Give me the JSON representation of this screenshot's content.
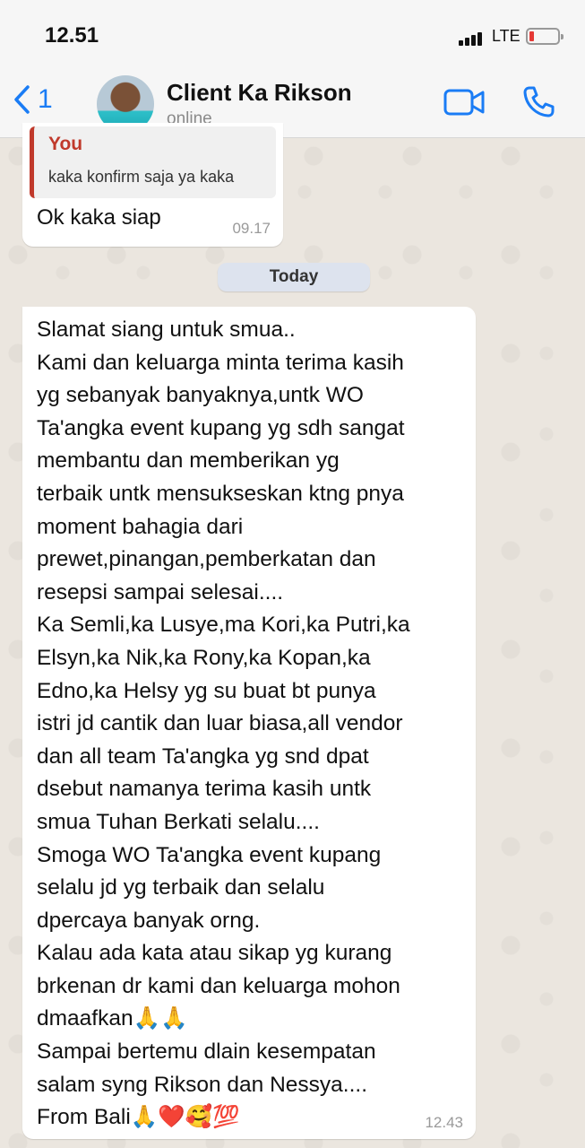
{
  "status_bar": {
    "time": "12.51",
    "network": "LTE",
    "battery_level": 0.1
  },
  "header": {
    "back_count": "1",
    "contact_name": "Client Ka Rikson",
    "contact_status": "online",
    "icons": [
      "chevron-left-icon",
      "video-icon",
      "phone-icon"
    ]
  },
  "messages": [
    {
      "quote_author": "You",
      "quote_text": "kaka konfirm saja ya kaka",
      "text": "Ok kaka siap",
      "time": "09.17"
    },
    {
      "lines": [
        "Slamat siang untuk smua..",
        "Kami dan keluarga minta terima kasih",
        "yg sebanyak banyaknya,untk WO",
        "Ta'angka event kupang yg sdh sangat",
        "membantu dan memberikan yg",
        "terbaik untk mensukseskan ktng pnya",
        "moment bahagia dari",
        "prewet,pinangan,pemberkatan dan",
        "resepsi sampai selesai....",
        "Ka Semli,ka Lusye,ma Kori,ka Putri,ka",
        "Elsyn,ka Nik,ka Rony,ka Kopan,ka",
        "Edno,ka Helsy yg su buat bt punya",
        "istri jd cantik dan luar biasa,all vendor",
        "dan all team Ta'angka yg snd dpat",
        "dsebut namanya terima kasih untk",
        "smua Tuhan Berkati selalu....",
        "Smoga WO Ta'angka event kupang",
        "selalu jd yg terbaik dan selalu",
        "dpercaya banyak orng.",
        "Kalau  ada kata atau sikap yg kurang",
        "brkenan dr kami dan keluarga mohon",
        "dmaafkan🙏🙏",
        "Sampai bertemu dlain kesempatan",
        "salam syng Rikson dan Nessya....",
        "From Bali🙏❤️🥰💯"
      ],
      "time": "12.43"
    }
  ],
  "day_separator": "Today",
  "colors": {
    "accent": "#1a7cf5",
    "quote_author": "#c0392b",
    "bubble": "#ffffff",
    "wallpaper": "#ebe6df"
  }
}
